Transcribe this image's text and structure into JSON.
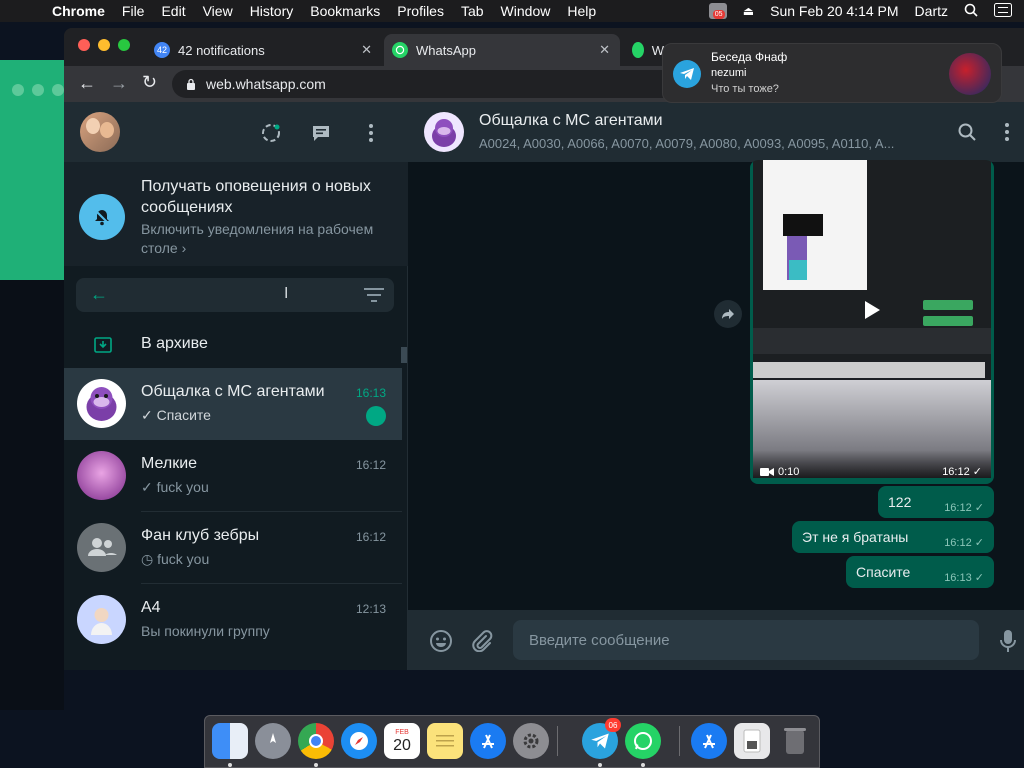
{
  "menubar": {
    "app": "Chrome",
    "items": [
      "File",
      "Edit",
      "View",
      "History",
      "Bookmarks",
      "Profiles",
      "Tab",
      "Window",
      "Help"
    ],
    "status_badge": "05",
    "datetime": "Sun Feb 20  4:14 PM",
    "user": "Dartz"
  },
  "browser": {
    "tabs": [
      {
        "label": "42 notifications",
        "badge": "42"
      },
      {
        "label": "WhatsApp"
      },
      {
        "label": "W"
      }
    ],
    "url": "web.whatsapp.com"
  },
  "sidebar": {
    "notification_banner": {
      "title": "Получать оповещения о новых сообщениях",
      "subtitle": "Включить уведомления на рабочем столе ›"
    },
    "archived_label": "В архиве",
    "chats": [
      {
        "name": "Общалка с МС агентами",
        "time": "16:13",
        "last_message": "✓ Спасите",
        "unread": true
      },
      {
        "name": "Мелкие",
        "time": "16:12",
        "last_message": "✓ fuck you",
        "unread": false
      },
      {
        "name": "Фан клуб зебры",
        "time": "16:12",
        "last_message": "◷ fuck you",
        "unread": false
      },
      {
        "name": "A4",
        "time": "12:13",
        "last_message": "Вы покинули группу",
        "unread": false
      }
    ]
  },
  "conversation": {
    "title": "Общалка с МС агентами",
    "members": "A0024, A0030, A0066, A0070, A0079, A0080, A0093, A0095, A0110, A...",
    "video": {
      "duration": "0:10",
      "time": "16:12 ✓"
    },
    "messages": [
      {
        "text": "122",
        "time": "16:12 ✓"
      },
      {
        "text": "Эт не я братаны",
        "time": "16:12 ✓"
      },
      {
        "text": "Спасите",
        "time": "16:13 ✓"
      }
    ],
    "composer_placeholder": "Введите сообщение"
  },
  "toast": {
    "chat": "Беседа Фнаф",
    "sender": "nezumi",
    "message": "Что ты тоже?"
  },
  "dock": {
    "calendar_month": "FEB",
    "calendar_day": "20",
    "telegram_badge": "06"
  },
  "colors": {
    "accent": "#00a884",
    "bubble_out": "#005c4b",
    "panel": "#202c33",
    "background": "#0b141a"
  }
}
